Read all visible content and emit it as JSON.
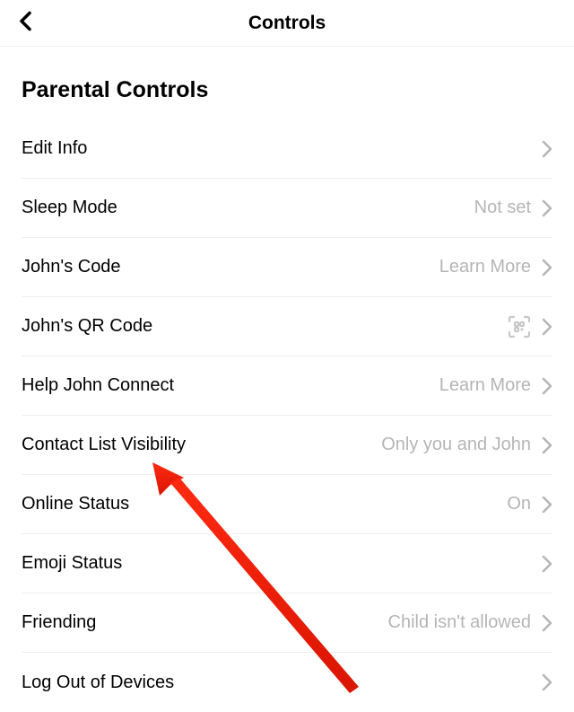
{
  "header": {
    "title": "Controls"
  },
  "section": {
    "title": "Parental Controls"
  },
  "rows": [
    {
      "label": "Edit Info",
      "value": ""
    },
    {
      "label": "Sleep Mode",
      "value": "Not set"
    },
    {
      "label": "John's Code",
      "value": "Learn More"
    },
    {
      "label": "John's QR Code",
      "value": "",
      "qr": true
    },
    {
      "label": "Help John Connect",
      "value": "Learn More"
    },
    {
      "label": "Contact List Visibility",
      "value": "Only you and John"
    },
    {
      "label": "Online Status",
      "value": "On"
    },
    {
      "label": "Emoji Status",
      "value": ""
    },
    {
      "label": "Friending",
      "value": "Child isn't allowed"
    },
    {
      "label": "Log Out of Devices",
      "value": ""
    }
  ]
}
